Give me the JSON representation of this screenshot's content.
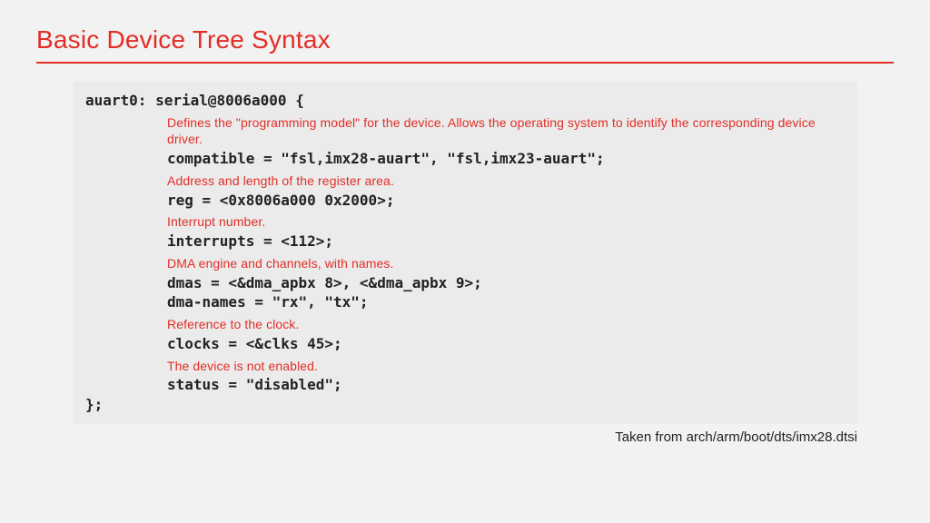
{
  "title": "Basic Device Tree Syntax",
  "code": {
    "open": "auart0: serial@8006a000 {",
    "close": "};",
    "items": [
      {
        "anno": "Defines the \"programming model\" for the device. Allows the operating system to identify the corresponding device driver.",
        "lines": [
          "compatible = \"fsl,imx28-auart\", \"fsl,imx23-auart\";"
        ]
      },
      {
        "anno": "Address and length of the register area.",
        "lines": [
          "reg = <0x8006a000 0x2000>;"
        ]
      },
      {
        "anno": "Interrupt number.",
        "lines": [
          "interrupts = <112>;"
        ]
      },
      {
        "anno": "DMA engine and channels, with names.",
        "lines": [
          "dmas = <&dma_apbx 8>, <&dma_apbx 9>;",
          "dma-names = \"rx\", \"tx\";"
        ]
      },
      {
        "anno": "Reference to the clock.",
        "lines": [
          "clocks = <&clks 45>;"
        ]
      },
      {
        "anno": "The device is not enabled.",
        "lines": [
          "status = \"disabled\";"
        ]
      }
    ]
  },
  "caption": "Taken from arch/arm/boot/dts/imx28.dtsi"
}
